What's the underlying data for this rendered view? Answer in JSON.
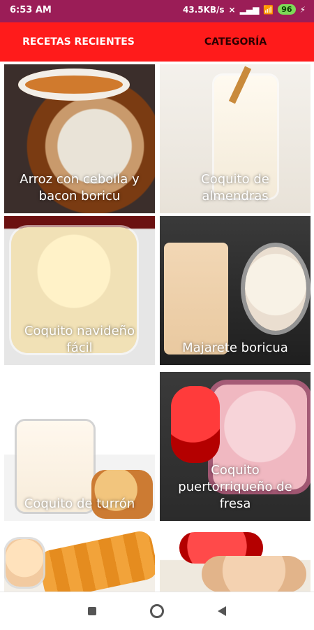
{
  "status_bar": {
    "time": "6:53 AM",
    "net_speed": "43.5KB/s",
    "battery": "96"
  },
  "tabs": [
    {
      "label": "RECETAS RECIENTES"
    },
    {
      "label": "CATEGORÍA"
    }
  ],
  "recipes": [
    {
      "title": "Arroz con cebolla y bacon boricu"
    },
    {
      "title": "Coquito de almendras"
    },
    {
      "title": "Coquito navideño fácil"
    },
    {
      "title": "Majarete boricua"
    },
    {
      "title": "Coquito de turrón"
    },
    {
      "title": "Coquito puertorriqueño de fresa"
    },
    {
      "title": ""
    },
    {
      "title": ""
    }
  ],
  "colors": {
    "status_bar": "#9b1d57",
    "tab_bar": "#ff1b1b"
  },
  "icons": {
    "status": [
      "mute-icon",
      "signal-icon",
      "wifi-icon",
      "battery-icon",
      "charging-icon"
    ],
    "nav": [
      "square-icon",
      "circle-icon",
      "back-triangle-icon"
    ]
  }
}
